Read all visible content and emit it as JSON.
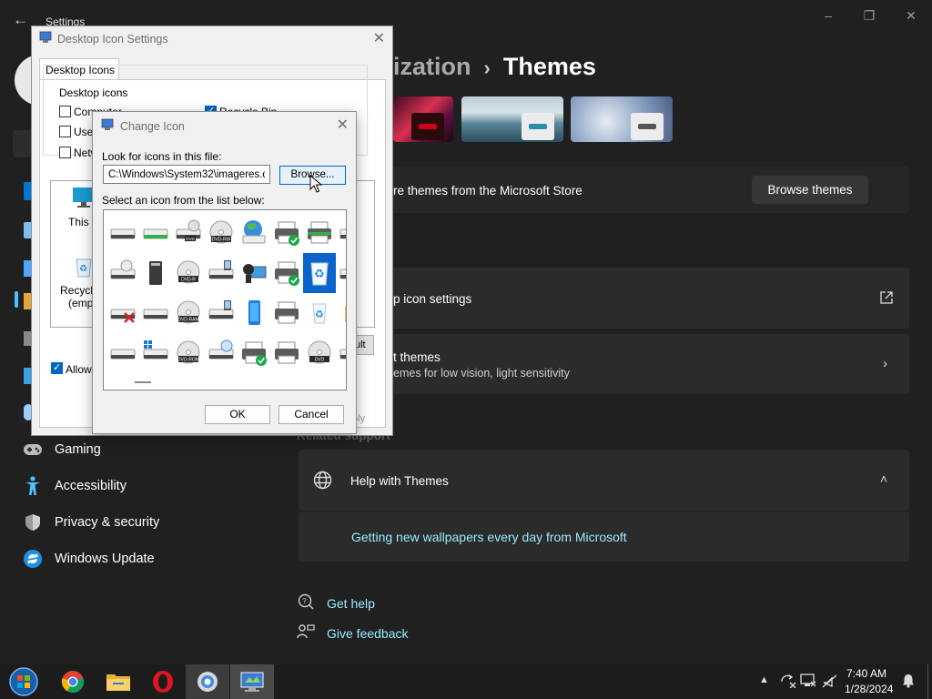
{
  "settings": {
    "window_title": "Settings",
    "breadcrumb_parent": "ization",
    "breadcrumb_sep": "›",
    "breadcrumb_current": "Themes",
    "store_text": "re themes from the Microsoft Store",
    "browse_themes": "Browse themes",
    "desktop_icon_settings": "p icon settings",
    "contrast_title": "t themes",
    "contrast_sub": "emes for low vision, light sensitivity",
    "related_support": "Related support",
    "help_with_themes": "Help with Themes",
    "wallpaper_link": "Getting new wallpapers every day from Microsoft",
    "get_help": "Get help",
    "give_feedback": "Give feedback",
    "nav": [
      {
        "label": "Gaming",
        "icon": "gamepad-icon"
      },
      {
        "label": "Accessibility",
        "icon": "accessibility-icon"
      },
      {
        "label": "Privacy & security",
        "icon": "shield-icon"
      },
      {
        "label": "Windows Update",
        "icon": "update-icon"
      }
    ],
    "accent_color": "#4cc2ff",
    "link_color": "#99ebff"
  },
  "desktop_icon_settings_dialog": {
    "title": "Desktop Icon Settings",
    "tab": "Desktop Icons",
    "group_label": "Desktop icons",
    "checkboxes": [
      {
        "label": "Computer",
        "checked": false
      },
      {
        "label": "User",
        "checked": false
      },
      {
        "label": "Netw",
        "checked": false
      },
      {
        "label": "Recycle Bin",
        "checked": true
      }
    ],
    "icons": [
      {
        "label": "This P"
      },
      {
        "label": "Recycle"
      },
      {
        "label": "(empt"
      }
    ],
    "restore_default": "ult",
    "allow_themes": "Allow t",
    "allow_checked": true,
    "apply": "ply"
  },
  "change_icon_dialog": {
    "title": "Change Icon",
    "look_label": "Look for icons in this file:",
    "path": "C:\\Windows\\System32\\imageres.dll",
    "browse": "Browse...",
    "select_label": "Select an icon from the list below:",
    "ok": "OK",
    "cancel": "Cancel",
    "selected_index": 14,
    "grid_icons": [
      "drive-icon",
      "drive-green-icon",
      "dvd-drive-icon",
      "dvd-rw-disc-icon",
      "network-globe-icon",
      "printer-check-icon",
      "printer-green-icon",
      "drive-icon",
      "drive-disc-icon",
      "memory-card-icon",
      "dvd-r-disc-icon",
      "drive-phone-icon",
      "camera-monitor-icon",
      "printer-check-icon",
      "recycle-bin-icon",
      "drive-icon",
      "drive-error-icon",
      "drive-icon",
      "dvd-ram-disc-icon",
      "drive-phone-icon",
      "phone-icon",
      "printer-icon",
      "recycle-bin-small-icon",
      "folder-icon",
      "drive-icon",
      "windows-drive-icon",
      "dvd-rom-disc-icon",
      "drive-remove-icon",
      "printer-check-icon",
      "printer-icon",
      "dvd-disc-icon",
      "drive-icon"
    ]
  },
  "taskbar": {
    "apps": [
      "start-orb-icon",
      "chrome-icon",
      "file-explorer-icon",
      "opera-icon",
      "control-panel-icon",
      "desktop-settings-icon"
    ],
    "time": "7:40 AM",
    "date": "1/28/2024"
  }
}
